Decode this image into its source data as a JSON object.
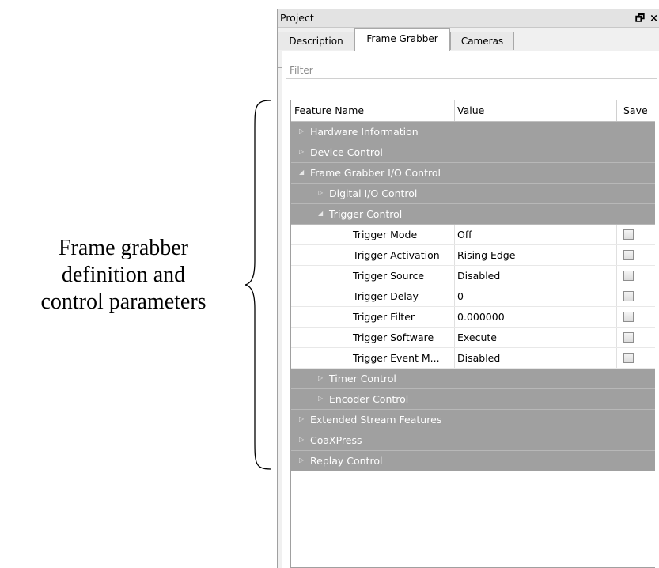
{
  "annotation": {
    "lines": [
      "Frame grabber",
      "definition and",
      "control parameters"
    ]
  },
  "panel": {
    "title": "Project",
    "icons": [
      "restore-icon",
      "close-icon"
    ],
    "icon_glyphs": {
      "restore": "🗗",
      "close": "×"
    }
  },
  "tabs": [
    "Description",
    "Frame Grabber",
    "Cameras"
  ],
  "active_tab": "Frame Grabber",
  "filter": {
    "placeholder": "Filter"
  },
  "grid": {
    "headers": {
      "feature": "Feature Name",
      "value": "Value",
      "save": "Save"
    },
    "rows": [
      {
        "type": "group",
        "level": 0,
        "expanded": false,
        "label": "Hardware Information"
      },
      {
        "type": "group",
        "level": 0,
        "expanded": false,
        "label": "Device Control"
      },
      {
        "type": "group",
        "level": 0,
        "expanded": true,
        "label": "Frame Grabber I/O Control"
      },
      {
        "type": "group",
        "level": 1,
        "expanded": false,
        "label": "Digital I/O Control"
      },
      {
        "type": "group",
        "level": 1,
        "expanded": true,
        "label": "Trigger Control"
      },
      {
        "type": "item",
        "label": "Trigger Mode",
        "value": "Off",
        "save": false
      },
      {
        "type": "item",
        "label": "Trigger Activation",
        "value": "Rising Edge",
        "save": false
      },
      {
        "type": "item",
        "label": "Trigger Source",
        "value": "Disabled",
        "save": false
      },
      {
        "type": "item",
        "label": "Trigger Delay",
        "value": "0",
        "save": false
      },
      {
        "type": "item",
        "label": "Trigger Filter",
        "value": "0.000000",
        "save": false
      },
      {
        "type": "item",
        "label": "Trigger Software",
        "value": "Execute",
        "save": false
      },
      {
        "type": "item",
        "label": "Trigger Event M...",
        "value": "Disabled",
        "save": false
      },
      {
        "type": "group",
        "level": 1,
        "expanded": false,
        "label": "Timer Control"
      },
      {
        "type": "group",
        "level": 1,
        "expanded": false,
        "label": "Encoder Control"
      },
      {
        "type": "group",
        "level": 0,
        "expanded": false,
        "label": "Extended Stream Features"
      },
      {
        "type": "group",
        "level": 0,
        "expanded": false,
        "label": "CoaXPress"
      },
      {
        "type": "group",
        "level": 0,
        "expanded": false,
        "label": "Replay Control"
      }
    ]
  },
  "colors": {
    "group_row": "#a0a0a0",
    "group_text": "#ffffff"
  }
}
